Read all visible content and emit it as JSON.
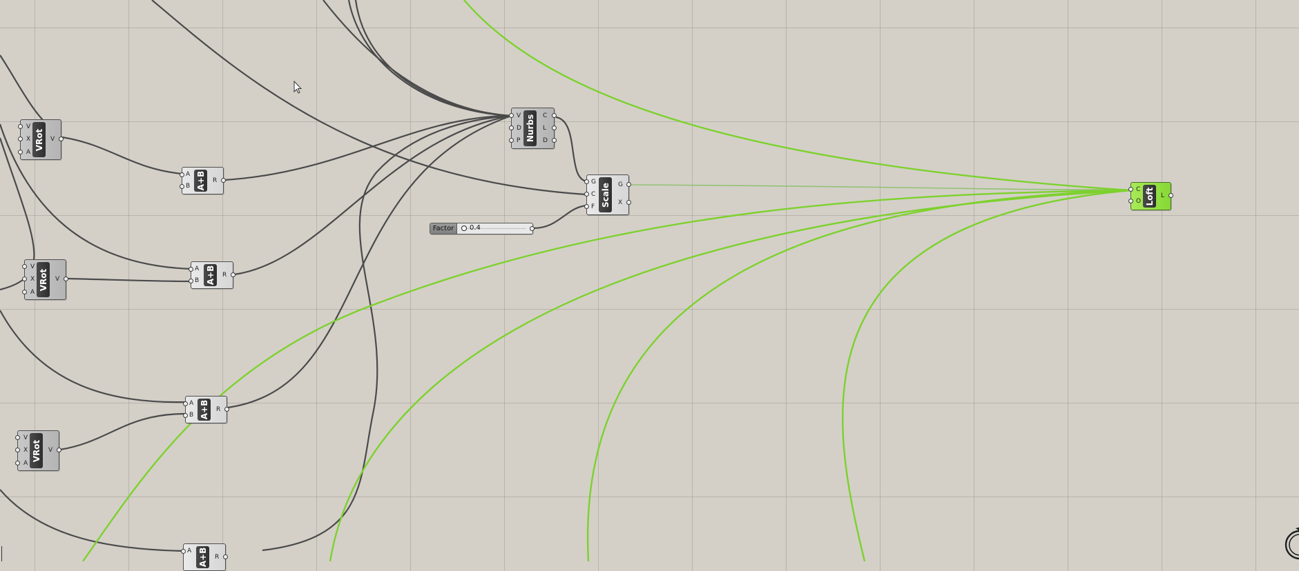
{
  "canvas": {
    "background": "#d4d0c8",
    "wire_color": "#4a4a4a",
    "selected_wire_color": "#7dd12d"
  },
  "components": {
    "vrot_1": {
      "label": "VRot",
      "inputs": [
        "V",
        "X",
        "A"
      ],
      "outputs": [
        "V"
      ]
    },
    "vrot_2": {
      "label": "VRot",
      "inputs": [
        "V",
        "X",
        "A"
      ],
      "outputs": [
        "V"
      ]
    },
    "vrot_3": {
      "label": "VRot",
      "inputs": [
        "V",
        "X",
        "A"
      ],
      "outputs": [
        "V"
      ]
    },
    "addition_1": {
      "label": "A+B",
      "inputs": [
        "A",
        "B"
      ],
      "outputs": [
        "R"
      ]
    },
    "addition_2": {
      "label": "A+B",
      "inputs": [
        "A",
        "B"
      ],
      "outputs": [
        "R"
      ]
    },
    "addition_3": {
      "label": "A+B",
      "inputs": [
        "A",
        "B"
      ],
      "outputs": [
        "R"
      ]
    },
    "addition_4": {
      "label": "A+B",
      "inputs": [
        "A",
        "B"
      ],
      "outputs": [
        "R"
      ]
    },
    "nurbs": {
      "label": "Nurbs",
      "inputs": [
        "V",
        "D",
        "P"
      ],
      "outputs": [
        "C",
        "L",
        "D"
      ]
    },
    "scale": {
      "label": "Scale",
      "inputs": [
        "G",
        "C",
        "F"
      ],
      "outputs": [
        "G",
        "X"
      ]
    },
    "loft": {
      "label": "Loft",
      "inputs": [
        "C",
        "O"
      ],
      "outputs": [
        "L"
      ],
      "color": "#8fdc3e"
    }
  },
  "factor_slider": {
    "label": "Factor",
    "value": "0.4"
  },
  "icons": {
    "cursor": "arrow-cursor-icon",
    "timer": "timer-dial-icon"
  }
}
